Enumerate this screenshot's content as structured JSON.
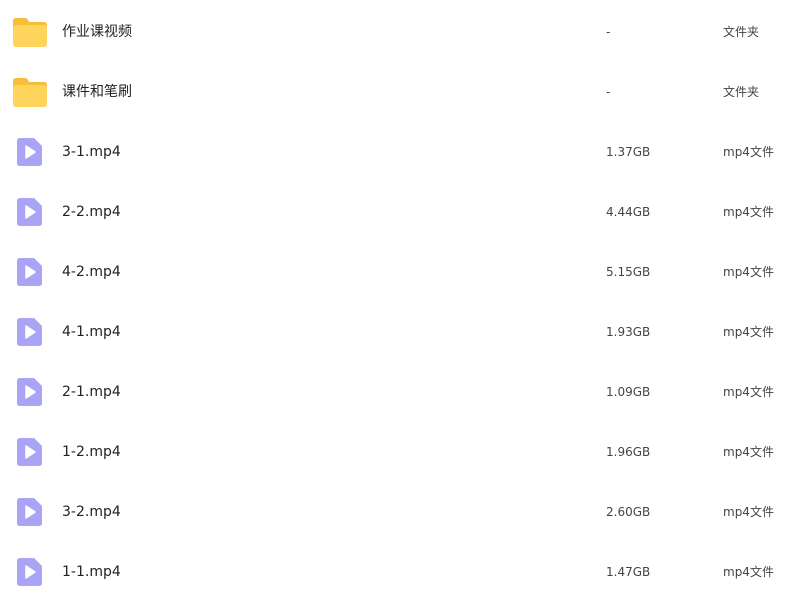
{
  "items": [
    {
      "name": "作业课视频",
      "size": "-",
      "type": "文件夹",
      "icon": "folder-icon"
    },
    {
      "name": "课件和笔刷",
      "size": "-",
      "type": "文件夹",
      "icon": "folder-icon"
    },
    {
      "name": "3-1.mp4",
      "size": "1.37GB",
      "type": "mp4文件",
      "icon": "video-file-icon"
    },
    {
      "name": "2-2.mp4",
      "size": "4.44GB",
      "type": "mp4文件",
      "icon": "video-file-icon"
    },
    {
      "name": "4-2.mp4",
      "size": "5.15GB",
      "type": "mp4文件",
      "icon": "video-file-icon"
    },
    {
      "name": "4-1.mp4",
      "size": "1.93GB",
      "type": "mp4文件",
      "icon": "video-file-icon"
    },
    {
      "name": "2-1.mp4",
      "size": "1.09GB",
      "type": "mp4文件",
      "icon": "video-file-icon"
    },
    {
      "name": "1-2.mp4",
      "size": "1.96GB",
      "type": "mp4文件",
      "icon": "video-file-icon"
    },
    {
      "name": "3-2.mp4",
      "size": "2.60GB",
      "type": "mp4文件",
      "icon": "video-file-icon"
    },
    {
      "name": "1-1.mp4",
      "size": "1.47GB",
      "type": "mp4文件",
      "icon": "video-file-icon"
    }
  ],
  "colors": {
    "folder_back": "#F7BE3A",
    "folder_front": "#FFD45C",
    "video_icon": "#A9A4F6",
    "play_glyph": "#FFFFFF"
  }
}
